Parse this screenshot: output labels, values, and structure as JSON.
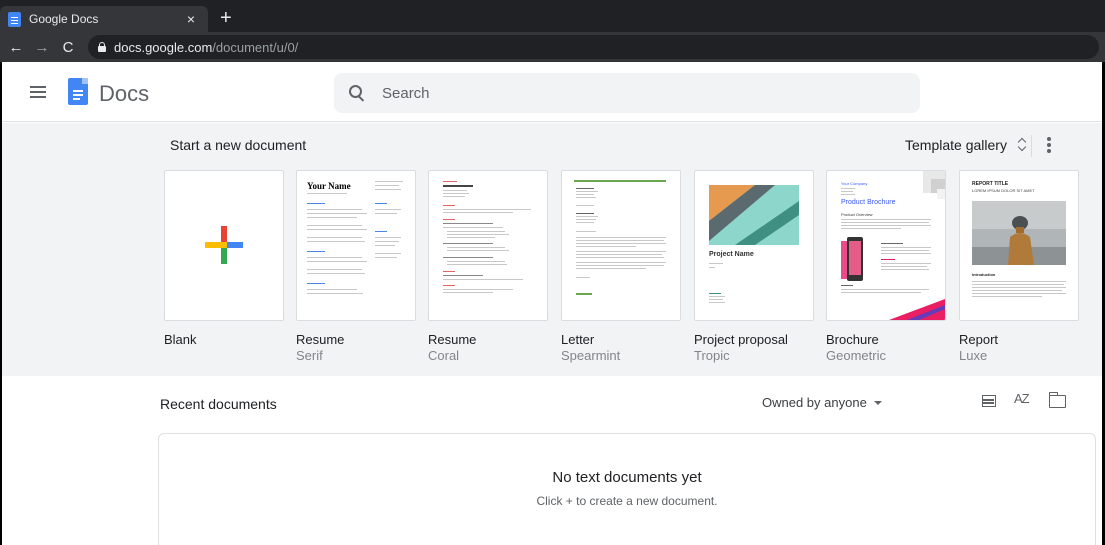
{
  "browser": {
    "tab_title": "Google Docs",
    "tab_close": "×",
    "new_tab": "+",
    "back": "←",
    "forward": "→",
    "reload": "C",
    "url_host": "docs.google.com",
    "url_path": "/document/u/0/"
  },
  "header": {
    "app_name": "Docs",
    "search_placeholder": "Search"
  },
  "templates": {
    "heading": "Start a new document",
    "gallery_label": "Template gallery",
    "items": [
      {
        "name": "Blank",
        "variant": ""
      },
      {
        "name": "Resume",
        "variant": "Serif"
      },
      {
        "name": "Resume",
        "variant": "Coral"
      },
      {
        "name": "Letter",
        "variant": "Spearmint"
      },
      {
        "name": "Project proposal",
        "variant": "Tropic"
      },
      {
        "name": "Brochure",
        "variant": "Geometric"
      },
      {
        "name": "Report",
        "variant": "Luxe"
      }
    ],
    "thumb_text": {
      "resume_name": "Your Name",
      "project_name": "Project Name",
      "company": "Your Company",
      "brochure_title": "Product Brochure",
      "brochure_sub": "Product Overview",
      "report_title": "REPORT TITLE",
      "report_sub": "LOREM IPSUM DOLOR SIT AMET",
      "report_intro": "Introduction"
    }
  },
  "recent": {
    "heading": "Recent documents",
    "owner_filter": "Owned by anyone",
    "sort_label": "AZ",
    "empty_title": "No text documents yet",
    "empty_hint": "Click + to create a new document."
  },
  "colors": {
    "brand_blue": "#4285f4",
    "plus_red": "#ea4335",
    "plus_yellow": "#fbbc04",
    "plus_green": "#34a853"
  }
}
